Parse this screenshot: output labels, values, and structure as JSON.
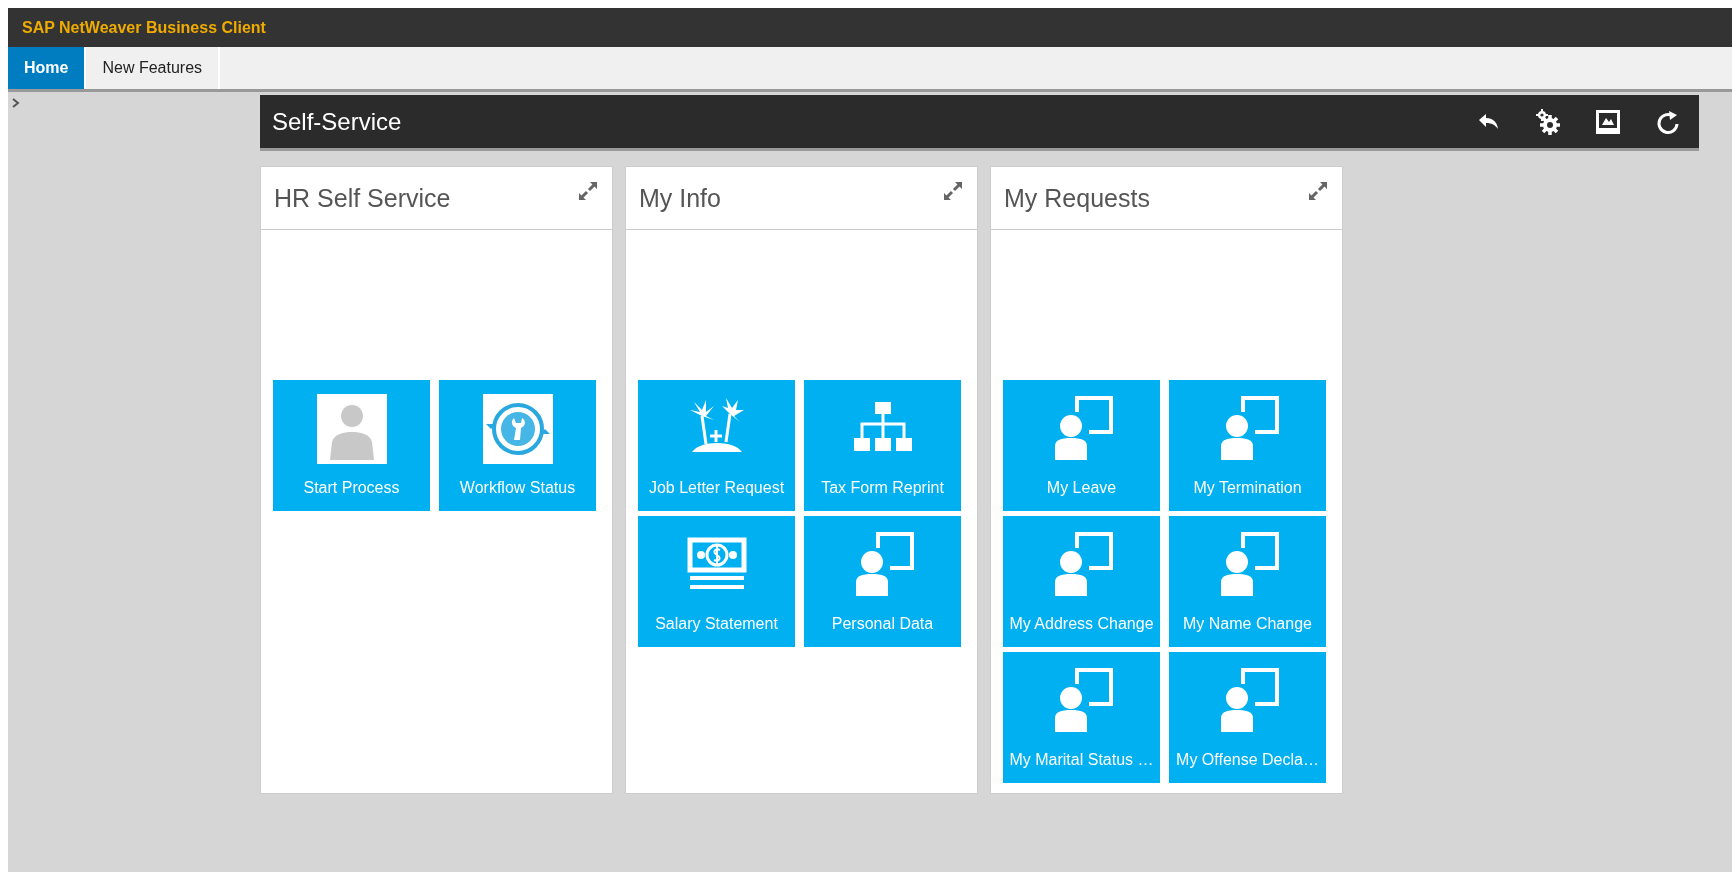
{
  "window": {
    "title": "SAP NetWeaver Business Client"
  },
  "tabs": [
    {
      "label": "Home",
      "selected": true
    },
    {
      "label": "New Features",
      "selected": false
    }
  ],
  "page": {
    "title": "Self-Service"
  },
  "cards": [
    {
      "title": "HR Self Service",
      "tiles": [
        {
          "label": "Start Process",
          "kind": "photo"
        },
        {
          "label": "Workflow Status",
          "kind": "workflow"
        }
      ]
    },
    {
      "title": "My Info",
      "tiles": [
        {
          "label": "Job Letter Request",
          "kind": "palms"
        },
        {
          "label": "Tax Form Reprint",
          "kind": "hierarchy"
        },
        {
          "label": "Salary Statement",
          "kind": "money"
        },
        {
          "label": "Personal Data",
          "kind": "person"
        }
      ]
    },
    {
      "title": "My Requests",
      "tiles": [
        {
          "label": "My Leave",
          "kind": "person"
        },
        {
          "label": "My Termination",
          "kind": "person"
        },
        {
          "label": "My Address Change",
          "kind": "person"
        },
        {
          "label": "My Name Change",
          "kind": "person"
        },
        {
          "label": "My Marital Status …",
          "kind": "person"
        },
        {
          "label": "My Offense Decla…",
          "kind": "person"
        }
      ]
    }
  ]
}
